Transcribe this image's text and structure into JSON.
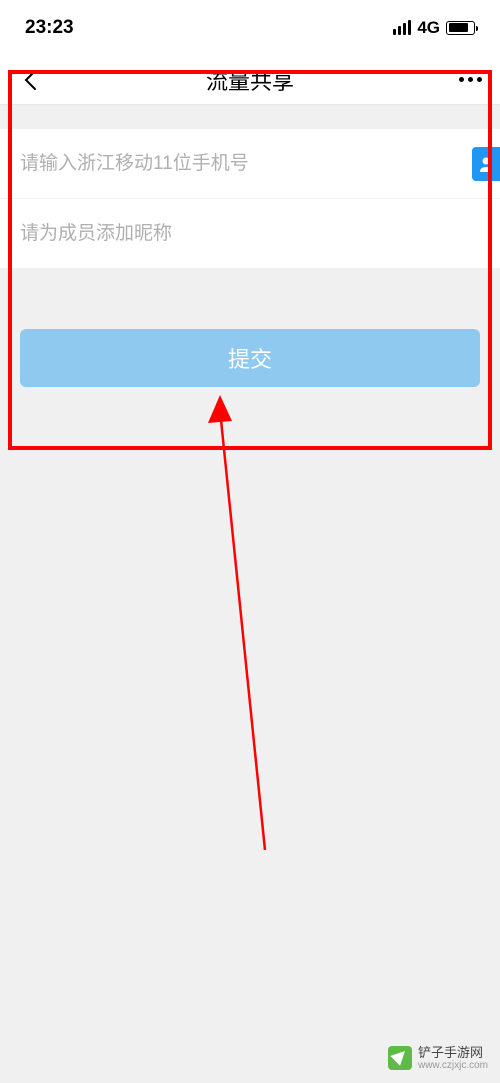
{
  "status": {
    "time": "23:23",
    "network": "4G"
  },
  "nav": {
    "title": "流量共享"
  },
  "inputs": {
    "phone": {
      "placeholder": "请输入浙江移动11位手机号",
      "value": ""
    },
    "nickname": {
      "placeholder": "请为成员添加昵称",
      "value": ""
    }
  },
  "buttons": {
    "submit": "提交"
  },
  "watermark": {
    "name": "铲子手游网",
    "url": "www.czjxjc.com"
  }
}
